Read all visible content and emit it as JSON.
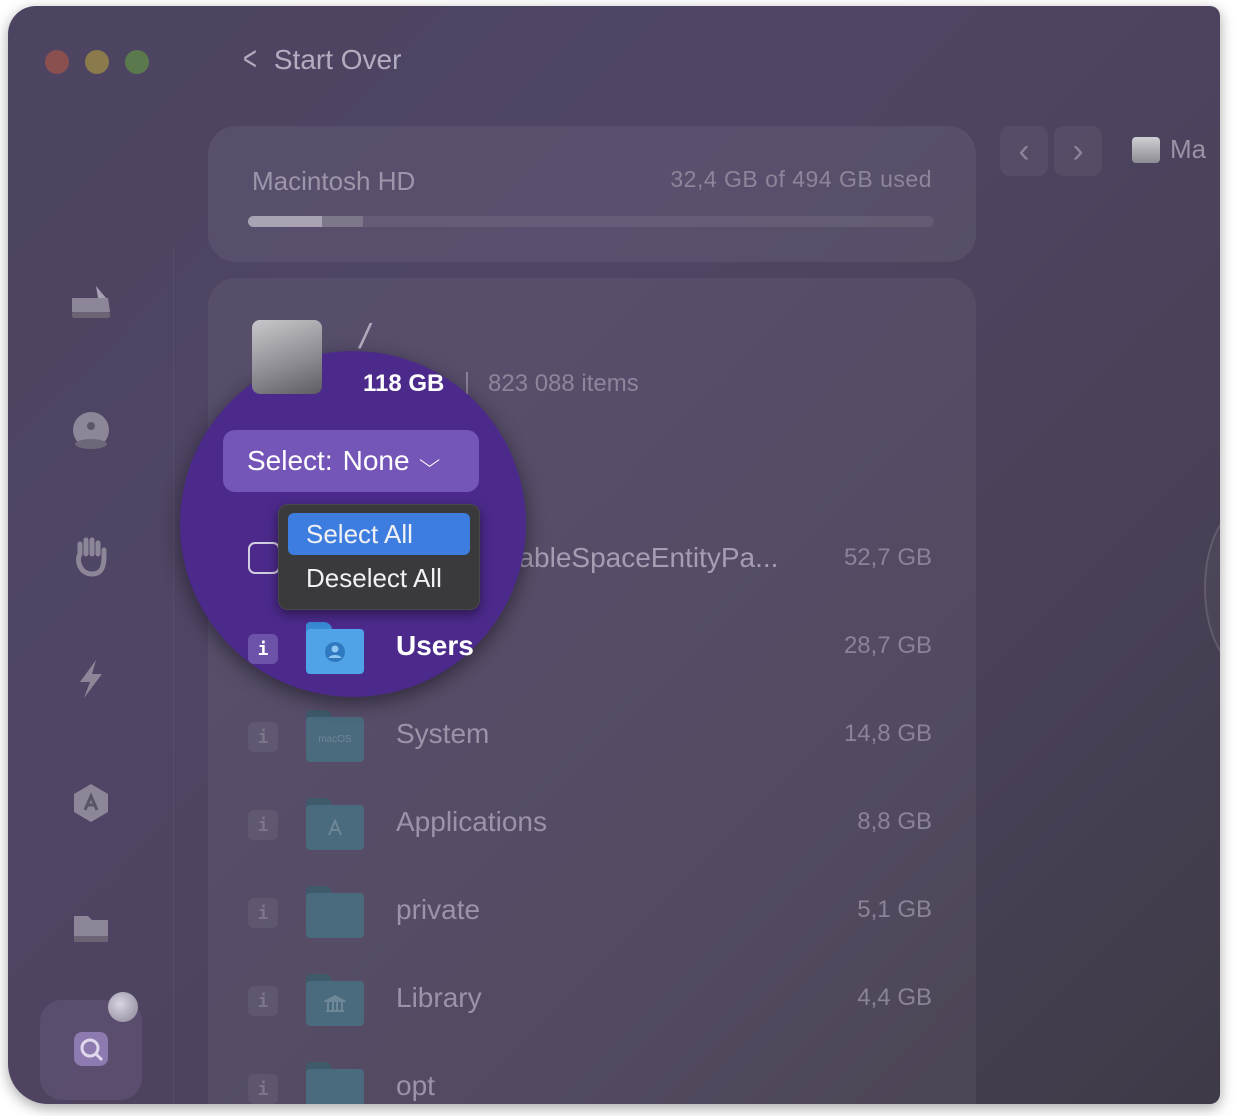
{
  "window": {
    "back_label": "Start Over"
  },
  "sidebar": {
    "items": [
      {
        "icon": "disk-cleanup-icon"
      },
      {
        "icon": "protection-icon"
      },
      {
        "icon": "privacy-hand-icon"
      },
      {
        "icon": "speed-bolt-icon"
      },
      {
        "icon": "applications-icon"
      },
      {
        "icon": "files-icon"
      },
      {
        "icon": "space-lens-icon",
        "active": true
      }
    ]
  },
  "disk": {
    "name": "Macintosh HD",
    "used_text": "32,4 GB of 494 GB used",
    "usage_fraction": 0.065,
    "secondary_fraction": 0.09
  },
  "breadcrumb": {
    "label": "Ma"
  },
  "root": {
    "path": "/",
    "size": "118 GB",
    "items": "823 088 items"
  },
  "select": {
    "label": "Select:",
    "value": "None",
    "options": [
      "Select All",
      "Deselect All"
    ],
    "highlighted": "Select All"
  },
  "rows": [
    {
      "name": "PurgeableSpaceEntityPa...",
      "visible_name": "rgeableSpaceEntityPa...",
      "size": "52,7 GB",
      "control": "checkbox"
    },
    {
      "name": "Users",
      "size": "28,7 GB",
      "control": "info",
      "info": "i"
    },
    {
      "name": "System",
      "size": "14,8 GB",
      "control": "info",
      "info": "i",
      "folder_label": "macOS"
    },
    {
      "name": "Applications",
      "size": "8,8 GB",
      "control": "info",
      "info": "i"
    },
    {
      "name": "private",
      "size": "5,1 GB",
      "control": "info",
      "info": "i"
    },
    {
      "name": "Library",
      "size": "4,4 GB",
      "control": "info",
      "info": "i"
    },
    {
      "name": "opt",
      "size": "",
      "control": "info",
      "info": "i"
    }
  ],
  "colors": {
    "highlight": "#3d7de0",
    "magnifier": "#4c2a8c",
    "folder_blue": "#4fa3e6"
  }
}
